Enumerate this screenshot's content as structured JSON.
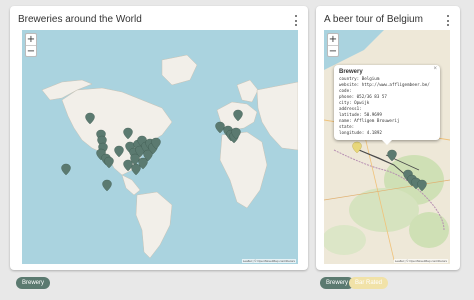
{
  "left_card": {
    "title": "Breweries around the World",
    "zoom_in": "+",
    "zoom_out": "−",
    "attribution": "Leaflet | © OpenStreetMap contributors",
    "legend_chip": "Brewery"
  },
  "right_card": {
    "title": "A beer tour of Belgium",
    "zoom_in": "+",
    "zoom_out": "−",
    "attribution": "Leaflet | © OpenStreetMap contributors",
    "popup": {
      "title": "Brewery",
      "close": "×",
      "lines": [
        "country: Belgium",
        "website: http://www.affligembeer.be/",
        "code:",
        "phone: 052/36 83 57",
        "city: Opwijk",
        "address1:",
        "latitude: 50.9699",
        "name: Affligem Brouwerij",
        "state:",
        "longitude: 4.1892"
      ]
    },
    "legend_chip_1": "Brewery",
    "legend_chip_2": "Bar Rated"
  },
  "colors": {
    "marker": "#5b7a70",
    "marker_alt": "#e8d77a",
    "route": "#4a4a4a",
    "water": "#aad3df",
    "land": "#f2efe9"
  }
}
